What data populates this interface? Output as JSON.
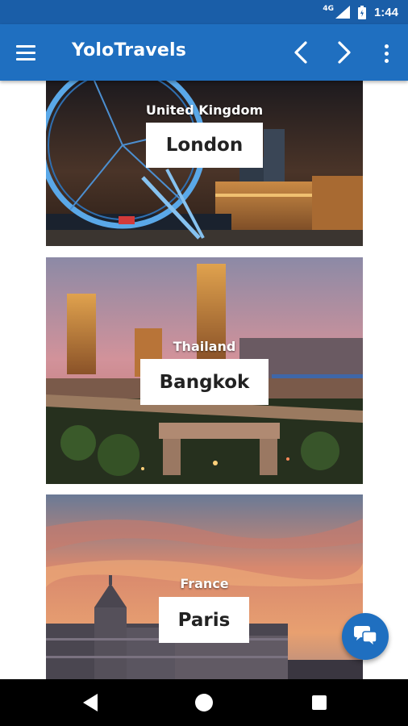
{
  "status_bar": {
    "network": "4G",
    "time": "1:44",
    "icons": [
      "signal-icon",
      "battery-icon"
    ]
  },
  "app_bar": {
    "title": "YoloTravels",
    "icons": [
      "menu-icon",
      "back-arrow-icon",
      "forward-arrow-icon",
      "more-vert-icon"
    ]
  },
  "destinations": [
    {
      "country": "United Kingdom",
      "city": "London"
    },
    {
      "country": "Thailand",
      "city": "Bangkok"
    },
    {
      "country": "France",
      "city": "Paris"
    }
  ],
  "fab": {
    "icon": "chat-bubbles-icon"
  },
  "nav_bar": {
    "icons": [
      "nav-back-icon",
      "nav-home-icon",
      "nav-recents-icon"
    ]
  },
  "colors": {
    "status_bar": "#1a5ea8",
    "app_bar": "#1f6fc0",
    "fab": "#1f6fc0",
    "nav_bar": "#000000"
  }
}
